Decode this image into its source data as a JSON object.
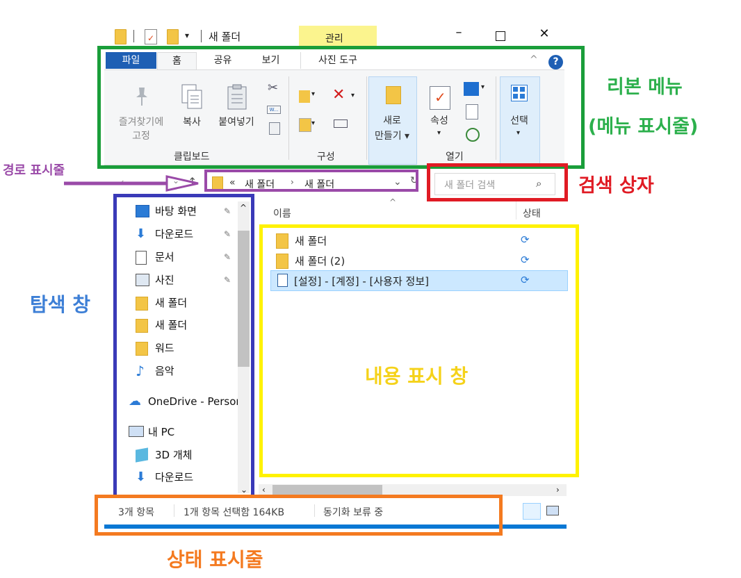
{
  "window": {
    "title": "새 폴더",
    "context_tab": "관리",
    "minimize_icon": "minimize-icon",
    "maximize_icon": "maximize-icon",
    "close_icon": "close-icon"
  },
  "ribbon": {
    "tabs": [
      "파일",
      "홈",
      "공유",
      "보기",
      "사진 도구"
    ],
    "clipboard": {
      "pin_label_1": "즐겨찾기에",
      "pin_label_2": "고정",
      "copy": "복사",
      "paste": "붙여넣기",
      "group": "클립보드"
    },
    "organize": {
      "group": "구성"
    },
    "new": {
      "label_1": "새로",
      "label_2": "만들기 ▾"
    },
    "open": {
      "properties": "속성",
      "group": "열기"
    },
    "select": {
      "label": "선택"
    }
  },
  "address": {
    "breadcrumb_prefix": "«",
    "crumbs": [
      "새 폴더",
      "새 폴더"
    ],
    "search_placeholder": "새 폴더 검색"
  },
  "content": {
    "columns": [
      "이름",
      "상태"
    ],
    "rows": [
      {
        "name": "새 폴더",
        "type": "folder"
      },
      {
        "name": "새 폴더 (2)",
        "type": "folder"
      },
      {
        "name": "[설정] - [계정] - [사용자 정보]",
        "type": "document",
        "selected": true
      }
    ]
  },
  "navigation": {
    "items": [
      {
        "label": "바탕 화면",
        "icon": "desktop-icon",
        "pinned": true
      },
      {
        "label": "다운로드",
        "icon": "download-icon",
        "pinned": true
      },
      {
        "label": "문서",
        "icon": "document-icon",
        "pinned": true
      },
      {
        "label": "사진",
        "icon": "picture-icon",
        "pinned": true
      },
      {
        "label": "새 폴더",
        "icon": "folder-icon",
        "pinned": false
      },
      {
        "label": "새 폴더",
        "icon": "folder-icon",
        "pinned": false
      },
      {
        "label": "워드",
        "icon": "folder-icon",
        "pinned": false
      },
      {
        "label": "음악",
        "icon": "music-icon",
        "pinned": false
      },
      {
        "label": "OneDrive - Persor",
        "icon": "onedrive-icon",
        "pinned": false
      },
      {
        "label": "내 PC",
        "icon": "pc-icon",
        "pinned": false
      },
      {
        "label": "3D 개체",
        "icon": "3d-objects-icon",
        "pinned": false
      },
      {
        "label": "다운로드",
        "icon": "download-icon",
        "pinned": false
      }
    ]
  },
  "status_bar": {
    "item_count": "3개 항목",
    "selection": "1개 항목 선택함 164KB",
    "sync": "동기화 보류 중"
  },
  "annotations": {
    "ribbon": "리본 메뉴",
    "ribbon_sub": "(메뉴 표시줄)",
    "path_bar": "경로 표시줄",
    "search_box": "검색 상자",
    "nav_pane": "탐색 창",
    "content_pane": "내용 표시 창",
    "status_bar": "상태 표시줄"
  },
  "colors": {
    "ribbon_box": "#1a9e3a",
    "path_box": "#9a4aa8",
    "search_box": "#e01b24",
    "nav_box": "#3a3ab8",
    "content_box": "#fff200",
    "status_box": "#f47a20",
    "ribbon_text": "#2cb04c",
    "nav_text": "#3d7fd6",
    "content_text": "#f5d21a",
    "file_tab": "#1e5fb4"
  }
}
